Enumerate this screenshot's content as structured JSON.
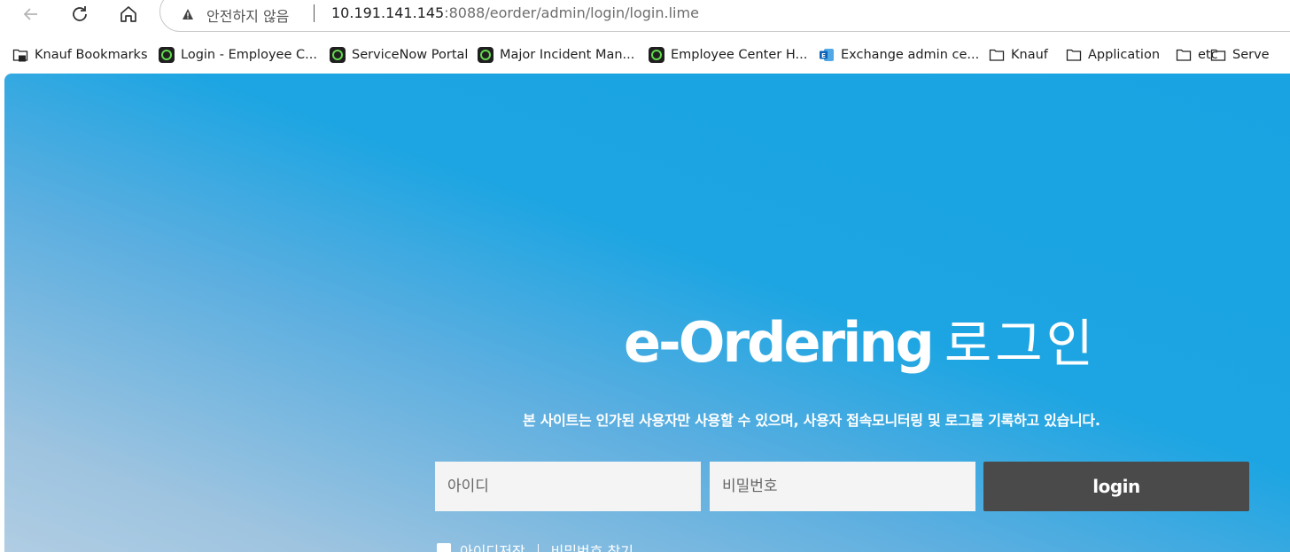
{
  "browser": {
    "not_secure_label": "안전하지 않음",
    "url_host": "10.191.141.145",
    "url_path": ":8088/eorder/admin/login/login.lime"
  },
  "bookmarks": [
    {
      "label": "Knauf Bookmarks",
      "icon": "folder-lock-icon"
    },
    {
      "label": "Login - Employee C...",
      "icon": "servicenow-icon"
    },
    {
      "label": "ServiceNow Portal",
      "icon": "servicenow-icon"
    },
    {
      "label": "Major Incident Man...",
      "icon": "servicenow-icon"
    },
    {
      "label": "Employee Center H...",
      "icon": "servicenow-icon"
    },
    {
      "label": "Exchange admin ce...",
      "icon": "exchange-icon"
    },
    {
      "label": "Knauf",
      "icon": "folder-icon"
    },
    {
      "label": "Application",
      "icon": "folder-icon"
    },
    {
      "label": "etc",
      "icon": "folder-icon"
    },
    {
      "label": "Serve",
      "icon": "folder-icon"
    }
  ],
  "login": {
    "title_brand": "e-Ordering",
    "title_suffix": "로그인",
    "notice": "본 사이트는 인가된 사용자만 사용할 수 있으며, 사용자 접속모니터링 및 로그를 기록하고 있습니다.",
    "id_placeholder": "아이디",
    "pw_placeholder": "비밀번호",
    "login_label": "login",
    "save_id_label": "아이디저장",
    "find_pw_label": "비밀번호 찾기"
  },
  "colors": {
    "page_blue": "#1ca5e2",
    "button_gray": "#4a4a4a",
    "field_bg": "#f4f4f4"
  }
}
